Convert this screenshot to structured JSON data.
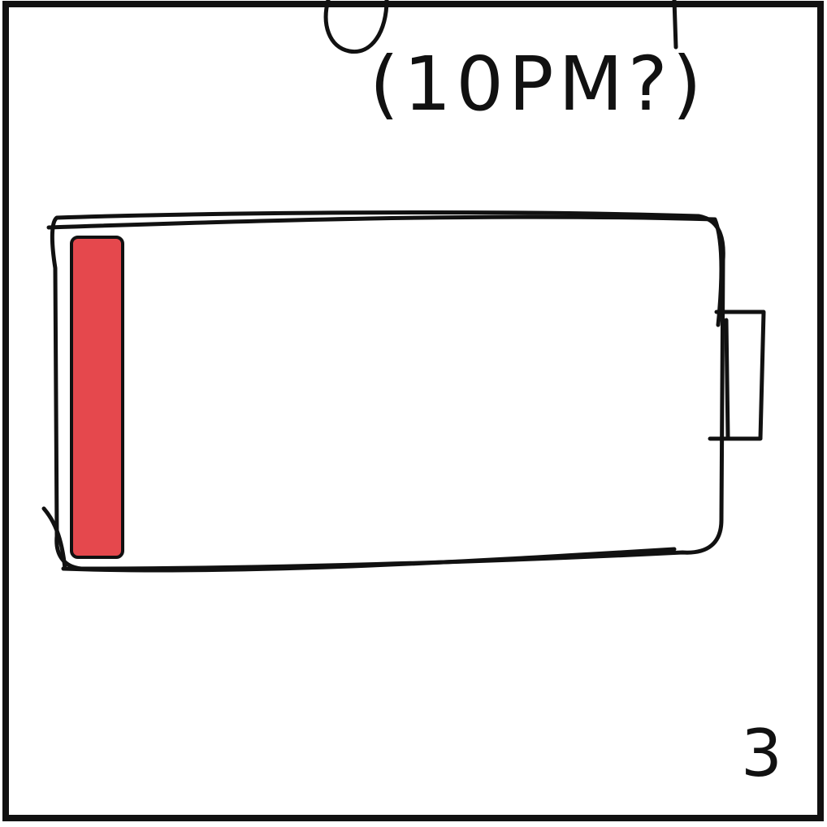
{
  "panel": {
    "time_note": "(10PM?)",
    "panel_number": "3"
  },
  "battery": {
    "charge_level": 0.08,
    "fill_color": "#e5484d",
    "outline_color": "#111111"
  },
  "icons": {
    "battery": "battery-low-icon"
  }
}
